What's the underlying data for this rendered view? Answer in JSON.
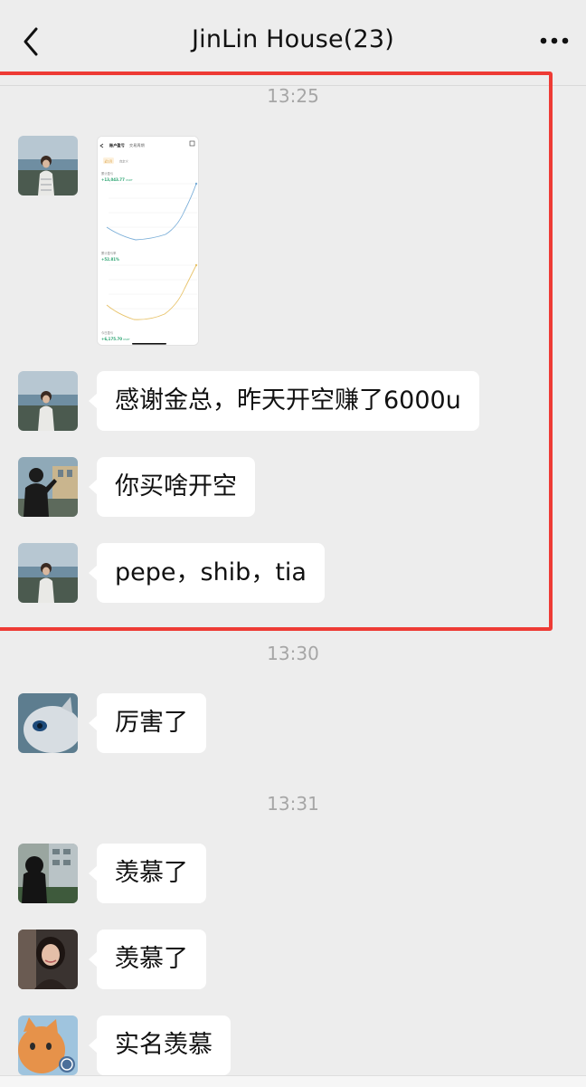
{
  "header": {
    "title": "JinLin House(23)",
    "back_icon": "chevron-left-icon",
    "more_icon": "more-dots-icon"
  },
  "timestamps": [
    "13:25",
    "13:30",
    "13:31"
  ],
  "messages": [
    {
      "avatar": "woman-seaside-avatar",
      "type": "image",
      "image": {
        "header_title": "账户盈亏",
        "header_tab": "交易周期",
        "tabs": [
          "近1月",
          "自定义"
        ],
        "section1": {
          "label": "累计盈亏",
          "value": "+13,043.77",
          "unit": "USDT"
        },
        "section2": {
          "label": "累计盈亏率",
          "value": "+52.81%"
        },
        "section3": {
          "label": "今日盈亏",
          "value": "+6,175.70",
          "unit": "USDT"
        }
      }
    },
    {
      "avatar": "woman-seaside-avatar",
      "type": "text",
      "text": "感谢金总，昨天开空赚了6000u"
    },
    {
      "avatar": "man-street-avatar",
      "type": "text",
      "text": "你买啥开空"
    },
    {
      "avatar": "woman-seaside-avatar",
      "type": "text",
      "text": "pepe，shib，tia"
    },
    {
      "avatar": "cat-avatar",
      "type": "text",
      "text": "厉害了"
    },
    {
      "avatar": "woman-dark-avatar",
      "type": "text",
      "text": "羡慕了"
    },
    {
      "avatar": "woman-car-avatar",
      "type": "text",
      "text": "羡慕了"
    },
    {
      "avatar": "orange-cat-avatar",
      "type": "text",
      "text": "实名羡慕"
    }
  ],
  "colors": {
    "background": "#ededed",
    "bubble": "#ffffff",
    "highlight": "#ee3b35",
    "timestamp": "#a6a6a6",
    "gain_green": "#2ba471"
  }
}
